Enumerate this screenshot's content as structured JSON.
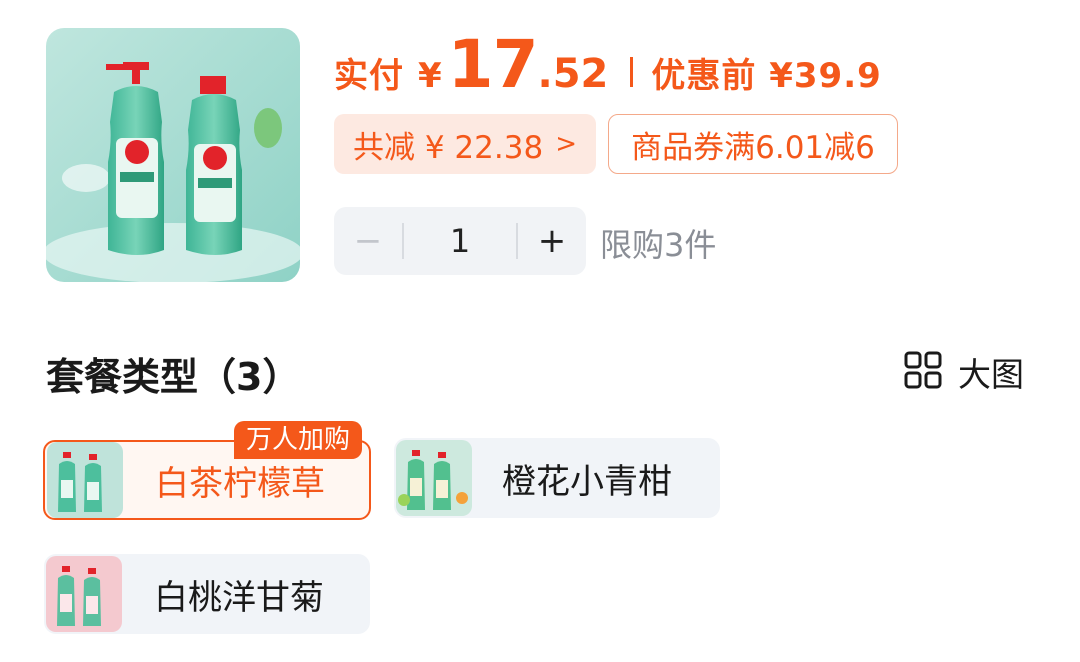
{
  "price": {
    "label": "实付",
    "currency": "¥",
    "integer": "17",
    "decimal": ".52",
    "original": "优惠前 ¥39.9"
  },
  "discount": {
    "total_label": "共减 ¥ 22.38",
    "chevron": ">",
    "coupon_label": "商品券满6.01减6"
  },
  "quantity": {
    "minus": "−",
    "value": "1",
    "plus": "+",
    "limit": "限购3件"
  },
  "package": {
    "title": "套餐类型（3）",
    "big_view_label": "大图",
    "big_view_icon": "grid-icon",
    "badge": "万人加购",
    "options": [
      {
        "label": "白茶柠檬草",
        "selected": true
      },
      {
        "label": "橙花小青柑",
        "selected": false
      },
      {
        "label": "白桃洋甘菊",
        "selected": false
      }
    ]
  },
  "colors": {
    "accent": "#f4581a",
    "chip_bg": "#fde9e1",
    "option_bg": "#f1f4f8"
  }
}
